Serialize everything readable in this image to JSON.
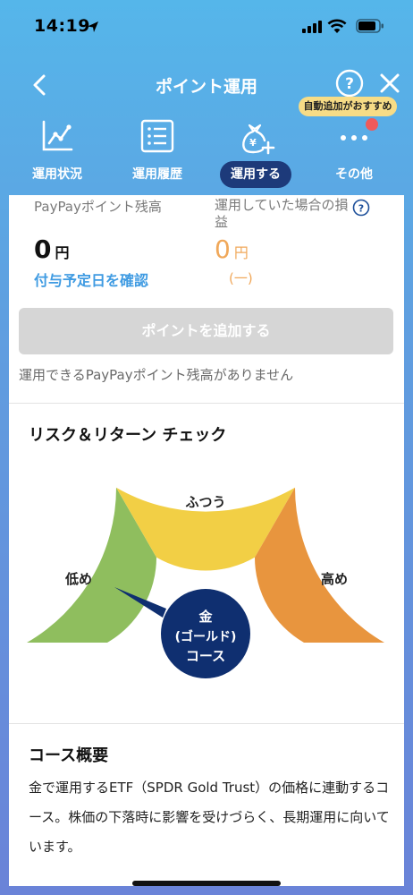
{
  "status_bar": {
    "time": "14:19"
  },
  "header": {
    "title": "ポイント運用",
    "badge": "自動追加がおすすめ"
  },
  "tabs": [
    {
      "label": "運用状況",
      "icon": "chart-line-icon",
      "active": false
    },
    {
      "label": "運用履歴",
      "icon": "list-icon",
      "active": false
    },
    {
      "label": "運用する",
      "icon": "money-bag-plus-icon",
      "active": true
    },
    {
      "label": "その他",
      "icon": "more-dots-icon",
      "active": false
    }
  ],
  "balance": {
    "label": "PayPayポイント残高",
    "value": "0",
    "unit": "円",
    "confirm_link": "付与予定日を確認"
  },
  "profit_loss": {
    "label": "運用していた場合の損益",
    "value": "0",
    "unit": "円",
    "sub": "(一)"
  },
  "add_button": "ポイントを追加する",
  "no_balance_message": "運用できるPayPayポイント残高がありません",
  "risk": {
    "title": "リスク＆リターン チェック",
    "low_label": "低め",
    "mid_label": "ふつう",
    "high_label": "高め",
    "center_line1": "金",
    "center_line2": "(ゴールド)",
    "center_line3": "コース",
    "colors": {
      "low": "#8fbe5e",
      "mid": "#f2cf45",
      "high": "#e8953e",
      "center": "#0f2f70"
    },
    "needle_segment": "low"
  },
  "overview": {
    "title": "コース概要",
    "text": "金で運用するETF（SPDR Gold Trust）の価格に連動するコース。株価の下落時に影響を受けづらく、長期運用に向いています。"
  }
}
